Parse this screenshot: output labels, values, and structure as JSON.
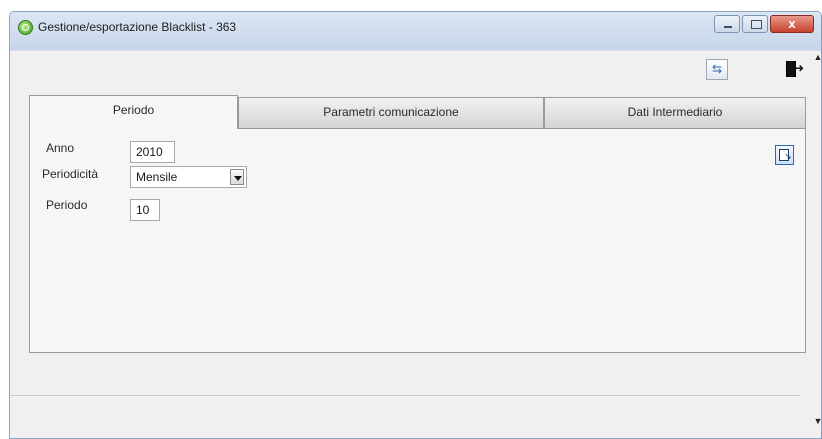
{
  "window": {
    "title": "Gestione/esportazione Blacklist - 363",
    "close_label": "x"
  },
  "toolbar": {
    "refresh_icon": "refresh-arrows-icon",
    "refresh_glyph": "⇆",
    "exit_icon": "exit-door-icon",
    "exit_glyph": "➜"
  },
  "tabs": [
    {
      "label": "Periodo",
      "active": true
    },
    {
      "label": "Parametri comunicazione",
      "active": false
    },
    {
      "label": "Dati Intermediario",
      "active": false
    }
  ],
  "form": {
    "anno_label": "Anno",
    "anno_value": "2010",
    "periodicita_label": "Periodicità",
    "periodicita_value": "Mensile",
    "periodo_label": "Periodo",
    "periodo_value": "10"
  },
  "scroll": {
    "up_glyph": "▲",
    "down_glyph": "▼"
  },
  "colors": {
    "titlebar": "#c6d6ea",
    "close_button": "#c6412d",
    "accent_blue": "#2f67b6"
  }
}
